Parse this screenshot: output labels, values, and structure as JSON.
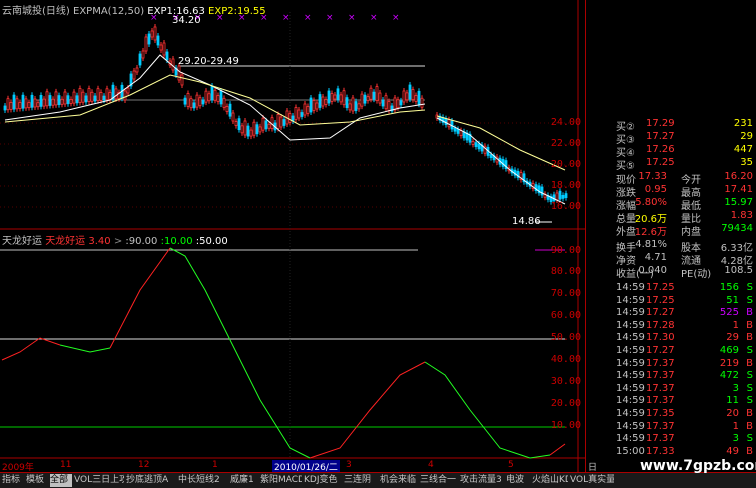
{
  "header": {
    "stock": "云南城投(日线)",
    "indicator": "EXPMA(12,50)",
    "exp1": "EXP1:16.63",
    "exp2": "EXP2:19.55"
  },
  "price_axis": [
    "24.00",
    "22.00",
    "20.00",
    "18.00",
    "16.00"
  ],
  "annotations": {
    "high": "34.20",
    "range": "29.20-29.49",
    "low": "14.86"
  },
  "sub_indicator": {
    "name": "天龙好运",
    "name_colored": "天龙好运",
    "value": "3.40",
    "levels": [
      ":90.00",
      ":10.00",
      ":50.00"
    ],
    "arrow": ">"
  },
  "sub_axis": [
    "90.00",
    "80.00",
    "70.00",
    "60.00",
    "50.00",
    "40.00",
    "30.00",
    "20.00",
    "10.00"
  ],
  "date_axis": [
    "2009年",
    "11",
    "12",
    "1",
    "2010/01/26/二",
    "3",
    "4",
    "5",
    "日线"
  ],
  "order_book": [
    {
      "label": "买②",
      "price": "17.29",
      "vol": "231"
    },
    {
      "label": "买③",
      "price": "17.27",
      "vol": "29"
    },
    {
      "label": "买④",
      "price": "17.26",
      "vol": "447"
    },
    {
      "label": "买⑤",
      "price": "17.25",
      "vol": "35"
    }
  ],
  "quote": [
    {
      "l1": "现价",
      "v1": "17.33",
      "l2": "今开",
      "v2": "16.20"
    },
    {
      "l1": "涨跌",
      "v1": "0.95",
      "l2": "最高",
      "v2": "17.41"
    },
    {
      "l1": "涨幅",
      "v1": "5.80%",
      "l2": "最低",
      "v2": "15.97"
    },
    {
      "l1": "总量",
      "v1": "20.6万",
      "l2": "量比",
      "v2": "1.83"
    },
    {
      "l1": "外盘",
      "v1": "12.6万",
      "l2": "内盘",
      "v2": "79434"
    }
  ],
  "stats": [
    {
      "l1": "换手",
      "v1": "4.81%",
      "l2": "股本",
      "v2": "6.33亿"
    },
    {
      "l1": "净资",
      "v1": "4.71",
      "l2": "流通",
      "v2": "4.28亿"
    },
    {
      "l1": "收益(一)",
      "v1": "0.040",
      "l2": "PE(动)",
      "v2": "108.5"
    }
  ],
  "ticks": [
    {
      "t": "14:59",
      "p": "17.25",
      "v": "156",
      "s": "S",
      "c": "#0f0"
    },
    {
      "t": "14:59",
      "p": "17.25",
      "v": "51",
      "s": "S",
      "c": "#0f0"
    },
    {
      "t": "14:59",
      "p": "17.27",
      "v": "525",
      "s": "B",
      "c": "#c0f"
    },
    {
      "t": "14:59",
      "p": "17.28",
      "v": "1",
      "s": "B",
      "c": "#f33"
    },
    {
      "t": "14:59",
      "p": "17.30",
      "v": "29",
      "s": "B",
      "c": "#f33"
    },
    {
      "t": "14:59",
      "p": "17.27",
      "v": "469",
      "s": "S",
      "c": "#0f0"
    },
    {
      "t": "14:59",
      "p": "17.37",
      "v": "219",
      "s": "B",
      "c": "#f33"
    },
    {
      "t": "14:59",
      "p": "17.37",
      "v": "472",
      "s": "S",
      "c": "#0f0"
    },
    {
      "t": "14:59",
      "p": "17.37",
      "v": "3",
      "s": "S",
      "c": "#0f0"
    },
    {
      "t": "14:59",
      "p": "17.37",
      "v": "11",
      "s": "S",
      "c": "#0f0"
    },
    {
      "t": "14:59",
      "p": "17.35",
      "v": "20",
      "s": "B",
      "c": "#f33"
    },
    {
      "t": "14:59",
      "p": "17.37",
      "v": "1",
      "s": "B",
      "c": "#f33"
    },
    {
      "t": "14:59",
      "p": "17.37",
      "v": "3",
      "s": "S",
      "c": "#0f0"
    },
    {
      "t": "15:00",
      "p": "17.33",
      "v": "49",
      "s": "B",
      "c": "#f33"
    }
  ],
  "tabs": [
    "指标",
    "模板",
    "全部",
    "VOL三日上攻",
    "抄底逃顶A",
    "中长短线2",
    "威廉1",
    "紫阳MACD",
    "KDJ变色",
    "三连阴",
    "机会来临",
    "三线合一",
    "攻击流量3",
    "电波",
    "火焰山KD",
    "VOL真实量"
  ],
  "active_tab": "全部",
  "watermark": "www.7gpzb.com"
}
